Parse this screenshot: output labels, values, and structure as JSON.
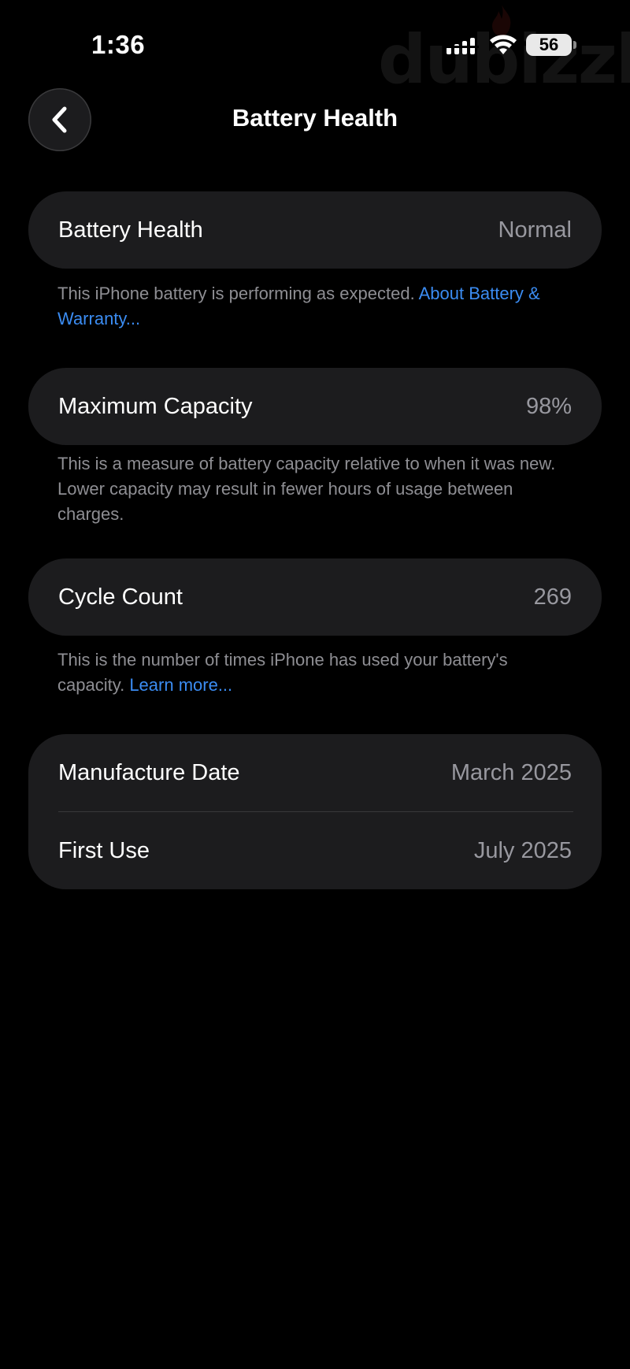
{
  "status_bar": {
    "time": "1:36",
    "battery_level": "56",
    "watermark": "dubizzle",
    "icons": [
      "signal-icon",
      "wifi-icon",
      "battery-icon"
    ]
  },
  "header": {
    "title": "Battery Health",
    "back_icon": "chevron-left-icon"
  },
  "battery_health": {
    "label": "Battery Health",
    "value": "Normal",
    "description": "This iPhone battery is performing as expected.",
    "link": "About Battery & Warranty..."
  },
  "maximum_capacity": {
    "label": "Maximum Capacity",
    "value": "98%",
    "description": "This is a measure of battery capacity relative to when it was new. Lower capacity may result in fewer hours of usage between charges."
  },
  "cycle_count": {
    "label": "Cycle Count",
    "value": "269",
    "description": "This is the number of times iPhone has used your battery's capacity.",
    "link": "Learn more..."
  },
  "dates": {
    "manufacture_label": "Manufacture Date",
    "manufacture_value": "March 2025",
    "first_use_label": "First Use",
    "first_use_value": "July 2025"
  },
  "colors": {
    "background": "#000000",
    "card": "#1c1c1e",
    "secondary_text": "#98989f",
    "footnote_text": "#8e8e93",
    "link": "#3b8cf2"
  }
}
